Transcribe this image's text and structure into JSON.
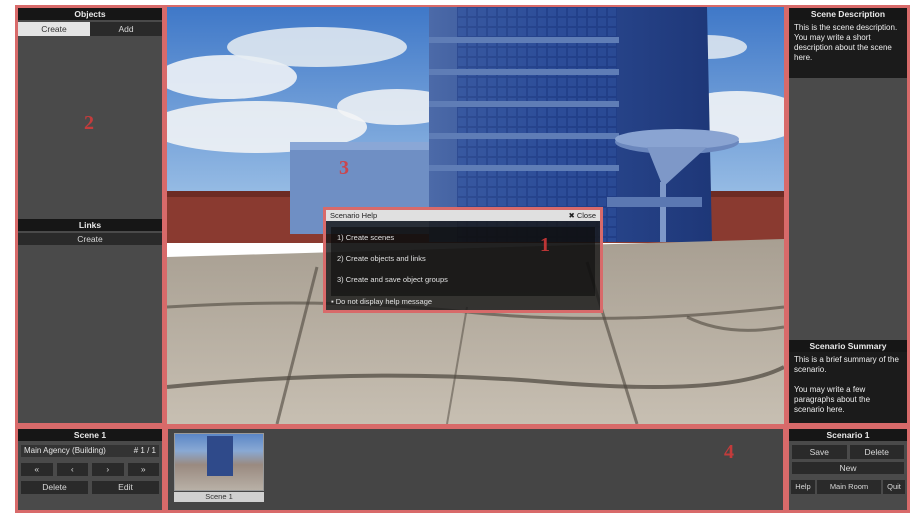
{
  "objects_panel": {
    "header": "Objects",
    "tabs": [
      {
        "label": "Create",
        "active": true
      },
      {
        "label": "Add",
        "active": false
      }
    ],
    "links_header": "Links",
    "links_create": "Create",
    "marker": "2"
  },
  "viewport": {
    "marker": "3"
  },
  "help_dialog": {
    "title": "Scenario Help",
    "close_label": "Close",
    "items": [
      "1) Create scenes",
      "2) Create objects and links",
      "3) Create and save object groups"
    ],
    "footer": "Do not display help message",
    "marker": "1"
  },
  "description_panel": {
    "description_header": "Scene Description",
    "description_text": "This is the scene description. You may write a short description about the scene here.",
    "summary_header": "Scenario Summary",
    "summary_text_1": "This is a brief summary of the scenario.",
    "summary_text_2": "You may write a few paragraphs about the scenario here."
  },
  "scene_panel": {
    "header": "Scene 1",
    "selected_model": "Main Agency (Building)",
    "selected_index": "# 1 / 1",
    "arrows": [
      "«",
      "‹",
      "›",
      "»"
    ],
    "delete_label": "Delete",
    "edit_label": "Edit"
  },
  "scene_strip": {
    "thumb_label": "Scene 1",
    "marker": "4"
  },
  "scenario_panel": {
    "header": "Scenario 1",
    "save_label": "Save",
    "delete_label": "Delete",
    "new_label": "New",
    "help_label": "Help",
    "main_room_label": "Main Room",
    "quit_label": "Quit"
  },
  "colors": {
    "highlight_border": "#d86a6a",
    "panel_bg": "#4a4a4a",
    "header_bg": "#161616",
    "marker": "#d93a3a"
  }
}
